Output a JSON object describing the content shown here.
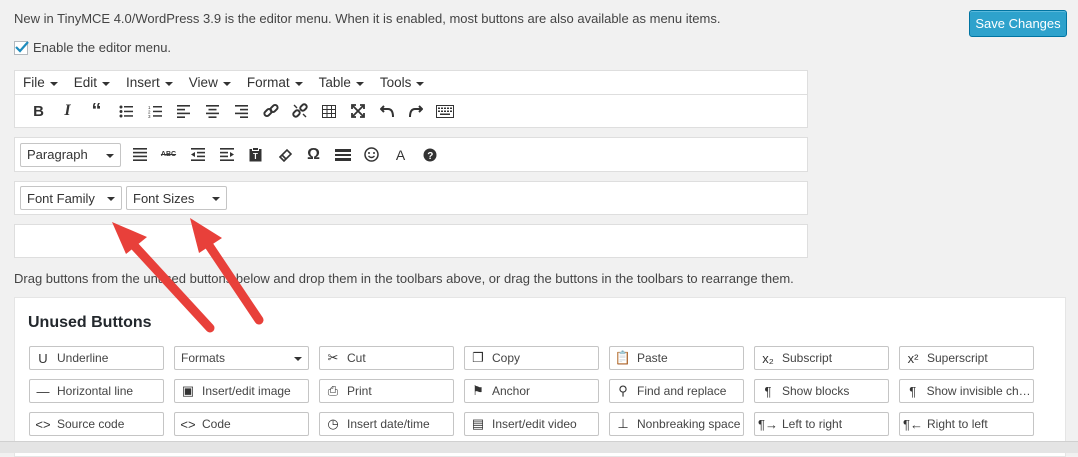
{
  "intro_text": "New in TinyMCE 4.0/WordPress 3.9 is the editor menu. When it is enabled, most buttons are also available as menu items.",
  "save_label": "Save Changes",
  "enable_menu_label": "Enable the editor menu.",
  "enable_menu_checked": true,
  "menubar": [
    "File",
    "Edit",
    "Insert",
    "View",
    "Format",
    "Table",
    "Tools"
  ],
  "toolbar1_icons": [
    "bold-icon",
    "italic-icon",
    "blockquote-icon",
    "bullet-list-icon",
    "numbered-list-icon",
    "align-left-icon",
    "align-center-icon",
    "align-right-icon",
    "link-icon",
    "unlink-icon",
    "table-icon",
    "fullscreen-icon",
    "undo-icon",
    "redo-icon",
    "kitchen-sink-icon"
  ],
  "format_select": "Paragraph",
  "toolbar2_icons": [
    "justify-icon",
    "strikethrough-icon",
    "outdent-icon",
    "indent-icon",
    "paste-text-icon",
    "clear-formatting-icon",
    "omega-icon",
    "horizontal-rule-icon",
    "emoticon-icon",
    "text-color-icon",
    "help-icon"
  ],
  "font_family_select": "Font Family",
  "font_sizes_select": "Font Sizes",
  "help_text": "Drag buttons from the unused buttons below and drop them in the toolbars above, or drag the buttons in the toolbars to rearrange them.",
  "unused_title": "Unused Buttons",
  "unused_buttons": [
    {
      "label": "Underline",
      "icon": "U"
    },
    {
      "label": "Formats",
      "icon": "",
      "select": true
    },
    {
      "label": "Cut",
      "icon": "✂"
    },
    {
      "label": "Copy",
      "icon": "❐"
    },
    {
      "label": "Paste",
      "icon": "📋"
    },
    {
      "label": "Subscript",
      "icon": "x₂"
    },
    {
      "label": "Superscript",
      "icon": "x²"
    },
    {
      "label": "Horizontal line",
      "icon": "—"
    },
    {
      "label": "Insert/edit image",
      "icon": "▣"
    },
    {
      "label": "Print",
      "icon": "⎙"
    },
    {
      "label": "Anchor",
      "icon": "⚑"
    },
    {
      "label": "Find and replace",
      "icon": "⚲"
    },
    {
      "label": "Show blocks",
      "icon": "¶"
    },
    {
      "label": "Show invisible cha...",
      "icon": "¶"
    },
    {
      "label": "Source code",
      "icon": "<>"
    },
    {
      "label": "Code",
      "icon": "<>"
    },
    {
      "label": "Insert date/time",
      "icon": "◷"
    },
    {
      "label": "Insert/edit video",
      "icon": "▤"
    },
    {
      "label": "Nonbreaking space",
      "icon": "⊥"
    },
    {
      "label": "Left to right",
      "icon": "¶→"
    },
    {
      "label": "Right to left",
      "icon": "¶←"
    }
  ],
  "accent_color": "#2ea2cc",
  "arrow_color": "#e8403a"
}
